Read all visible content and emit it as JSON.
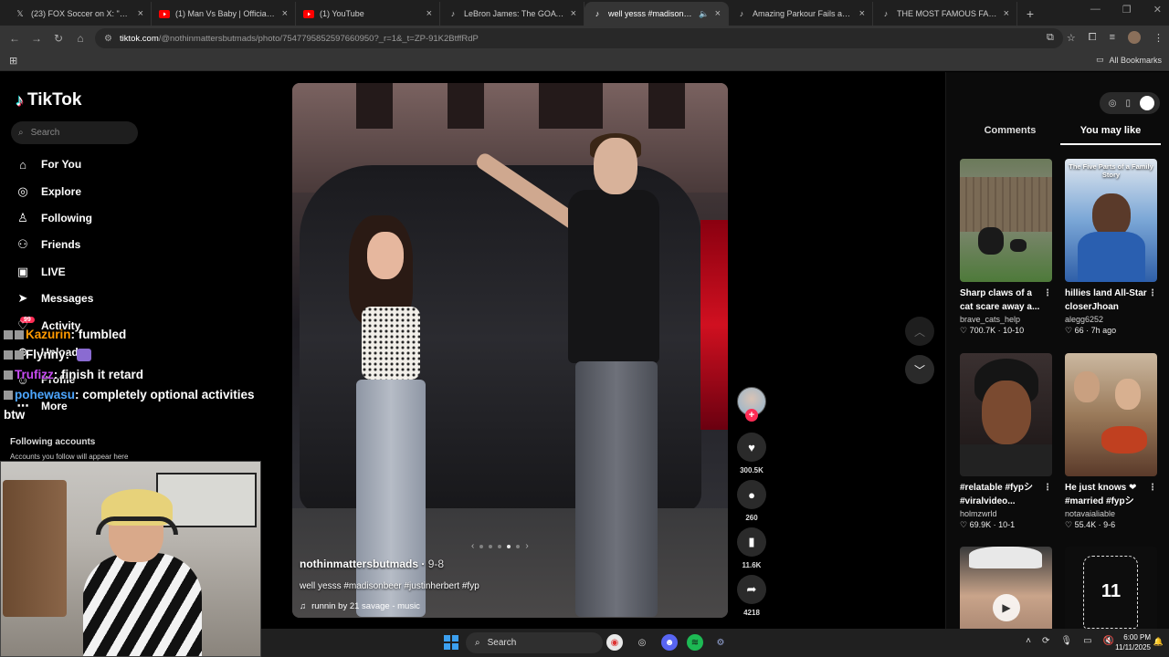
{
  "browser": {
    "tabs": [
      {
        "title": "(23) FOX Soccer on X: \"A BICYC",
        "icon": "x-icon",
        "active": false
      },
      {
        "title": "(1) Man Vs Baby | Official Traile",
        "icon": "youtube-icon",
        "active": false
      },
      {
        "title": "(1) YouTube",
        "icon": "youtube-icon",
        "active": false
      },
      {
        "title": "LeBron James: The GOAT Deba",
        "icon": "tiktok-icon",
        "active": false
      },
      {
        "title": "well yesss #madisonbeer #",
        "icon": "tiktok-icon",
        "active": true
      },
      {
        "title": "Amazing Parkour Fails and Extr",
        "icon": "tiktok-icon",
        "active": false
      },
      {
        "title": "THE MOST FAMOUS FASHION",
        "icon": "tiktok-icon",
        "active": false
      }
    ],
    "url_host": "tiktok.com",
    "url_path": "/@nothinmattersbutmads/photo/7547795852597660950?_r=1&_t=ZP-91K2BtffRdP",
    "all_bookmarks": "All Bookmarks"
  },
  "sidebar": {
    "logo": "TikTok",
    "search_placeholder": "Search",
    "items": [
      {
        "label": "For You",
        "icon": "home-icon"
      },
      {
        "label": "Explore",
        "icon": "compass-icon"
      },
      {
        "label": "Following",
        "icon": "following-icon"
      },
      {
        "label": "Friends",
        "icon": "friends-icon"
      },
      {
        "label": "LIVE",
        "icon": "live-icon"
      },
      {
        "label": "Messages",
        "icon": "messages-icon"
      },
      {
        "label": "Activity",
        "icon": "activity-icon"
      },
      {
        "label": "Upload",
        "icon": "upload-icon"
      },
      {
        "label": "Profile",
        "icon": "profile-icon"
      },
      {
        "label": "More",
        "icon": "more-icon"
      }
    ],
    "activity_badge": "99",
    "following_title": "Following accounts",
    "following_sub": "Accounts you follow will appear here"
  },
  "chat": [
    {
      "user": "Kazurin",
      "msg": "fumbled"
    },
    {
      "user": "Flynny",
      "msg": ""
    },
    {
      "user": "Trufizz",
      "msg": "finish it retard"
    },
    {
      "user": "pohewasu",
      "msg": "completely optional activities btw"
    }
  ],
  "post": {
    "author": "nothinmattersbutmads",
    "date": "9-8",
    "caption": "well yesss #madisonbeer #justinherbert #fyp",
    "music": "runnin by 21 savage - music",
    "likes": "300.5K",
    "comments": "260",
    "saves": "11.6K",
    "shares": "4218"
  },
  "right_panel": {
    "tabs": [
      "Comments",
      "You may like"
    ],
    "active_tab": "You may like",
    "cards": [
      {
        "title": "Sharp claws of a cat scare away a...",
        "author": "brave_cats_help",
        "likes": "700.7K",
        "date": "10-10",
        "thumb_text": "",
        "thumb_color": "#5b6b4a"
      },
      {
        "title": "hillies land All-Star closerJhoan Dura...",
        "author": "alegg6252",
        "likes": "66",
        "date": "7h ago",
        "thumb_text": "The Five Parts of a Family Story",
        "thumb_color": "#3a6ea8"
      },
      {
        "title": "#relatable #fypシ #viralvideo...",
        "author": "holmzwrld",
        "likes": "69.9K",
        "date": "10-1",
        "thumb_text": "",
        "thumb_color": "#3a2a24"
      },
      {
        "title": "He just knows ❤ #married #fypシ",
        "author": "notavaialiable",
        "likes": "55.4K",
        "date": "9-6",
        "thumb_text": "",
        "thumb_color": "#a0785a"
      },
      {
        "title": "",
        "author": "",
        "likes": "",
        "date": "",
        "thumb_text": "",
        "thumb_color": "#c9a48a"
      },
      {
        "title": "",
        "author": "",
        "likes": "",
        "date": "",
        "thumb_text": "11",
        "thumb_color": "#111111"
      }
    ]
  },
  "taskbar": {
    "search": "Search",
    "time": "6:00 PM",
    "date": "11/11/2025"
  }
}
